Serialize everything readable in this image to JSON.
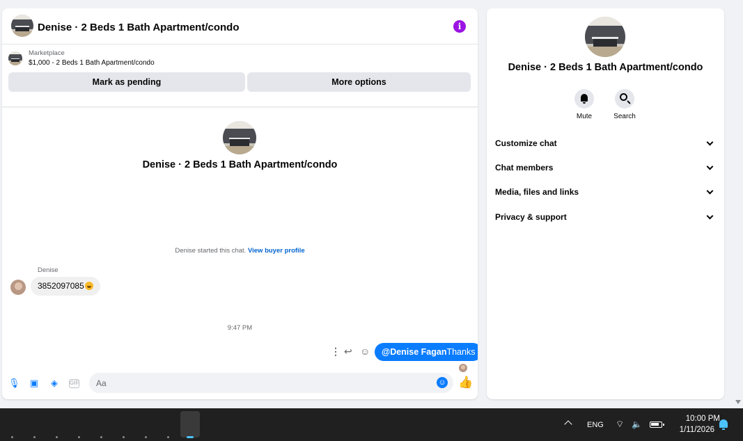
{
  "conversation": {
    "title": "Denise · 2 Beds 1 Bath Apartment/condo",
    "info_icon_glyph": "i"
  },
  "listing": {
    "label": "Marketplace",
    "summary": "$1,000 - 2 Beds 1 Bath Apartment/condo",
    "mark_pending_label": "Mark as pending",
    "more_options_label": "More options"
  },
  "thread": {
    "intro_title": "Denise · 2 Beds 1 Bath Apartment/condo",
    "started_text": "Denise started this chat.",
    "buyer_profile_link": "View buyer profile",
    "messages": [
      {
        "sender": "Denise",
        "text": "3852097085",
        "direction": "incoming",
        "emoji": "smiling-face"
      },
      {
        "mention": "@Denise Fagan",
        "text": "Thanks",
        "direction": "outgoing"
      }
    ],
    "timestamp": "9:47 PM"
  },
  "composer": {
    "placeholder": "Aa",
    "gif_label": "GIF"
  },
  "sidebar": {
    "title": "Denise · 2 Beds 1 Bath Apartment/condo",
    "actions": [
      {
        "label": "Mute",
        "icon": "bell-icon"
      },
      {
        "label": "Search",
        "icon": "search-icon"
      }
    ],
    "sections": [
      {
        "label": "Customize chat"
      },
      {
        "label": "Chat members"
      },
      {
        "label": "Media, files and links"
      },
      {
        "label": "Privacy & support"
      }
    ]
  },
  "taskbar": {
    "language": "ENG",
    "time": "10:00 PM",
    "date": "1/11/2026"
  },
  "colors": {
    "accent": "#0a7cff",
    "link": "#0064d1",
    "info": "#9b14e2",
    "taskbar": "#202020"
  }
}
